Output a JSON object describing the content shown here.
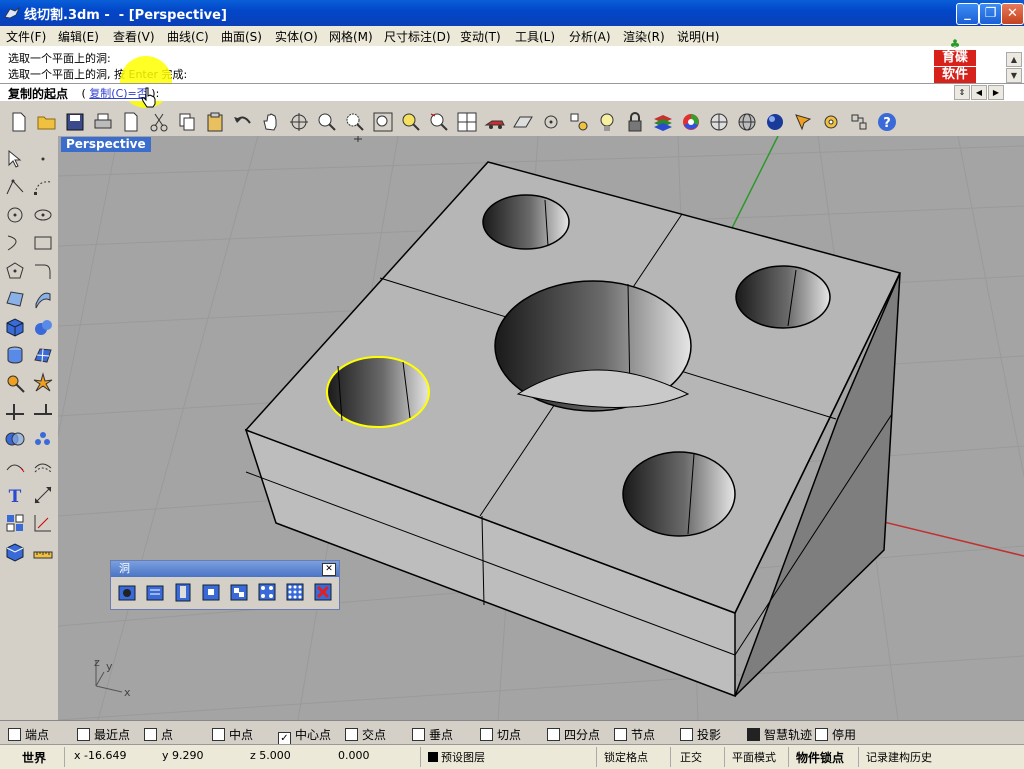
{
  "window": {
    "title": "线切割.3dm -  - [Perspective]",
    "minimize": "_",
    "restore": "❐",
    "close": "✕"
  },
  "menu": [
    "文件(F)",
    "编辑(E)",
    "查看(V)",
    "曲线(C)",
    "曲面(S)",
    "实体(O)",
    "网格(M)",
    "尺寸标注(D)",
    "变动(T)",
    "工具(L)",
    "分析(A)",
    "渲染(R)",
    "说明(H)"
  ],
  "command_history": [
    "选取一个平面上的洞:",
    "选取一个平面上的洞, 按 Enter 完成:"
  ],
  "logo": {
    "line1": "育碟",
    "line2": "软件"
  },
  "prompt": {
    "label": "复制的起点",
    "open": " ( ",
    "option": "复制(C)=否",
    "close": " ):"
  },
  "viewport": {
    "title": "Perspective",
    "axis_z": "z",
    "axis_y": "y",
    "axis_x": "x"
  },
  "hole_palette": {
    "title": "洞",
    "close": "✕"
  },
  "osnaps": [
    {
      "label": "端点",
      "checked": false
    },
    {
      "label": "最近点",
      "checked": false
    },
    {
      "label": "点",
      "checked": false
    },
    {
      "label": "中点",
      "checked": false
    },
    {
      "label": "中心点",
      "checked": true
    },
    {
      "label": "交点",
      "checked": false
    },
    {
      "label": "垂点",
      "checked": false
    },
    {
      "label": "切点",
      "checked": false
    },
    {
      "label": "四分点",
      "checked": false
    },
    {
      "label": "节点",
      "checked": false
    },
    {
      "label": "投影",
      "checked": false
    },
    {
      "label": "智慧轨迹",
      "checked": true
    },
    {
      "label": "停用",
      "checked": false
    }
  ],
  "status": {
    "cplane": "世界",
    "x": "x -16.649",
    "y": "y 9.290",
    "z": "z 5.000",
    "dist": "0.000",
    "layer": "预设图层",
    "grid_snap": "锁定格点",
    "ortho": "正交",
    "planar": "平面模式",
    "osnap": "物件锁点",
    "history": "记录建构历史"
  },
  "colors": {
    "title_bar": "#0247c9",
    "viewport_bg": "#a4a4a4",
    "selection": "#ffff00",
    "halo": "#ffff00"
  }
}
